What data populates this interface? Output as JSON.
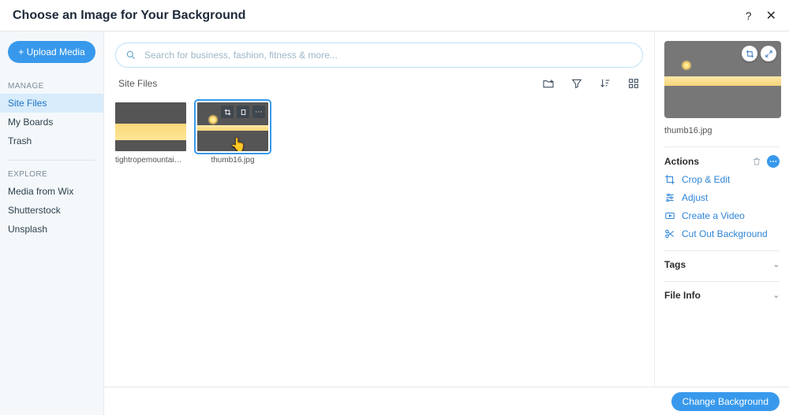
{
  "header": {
    "title": "Choose an Image for Your Background"
  },
  "sidebar": {
    "upload_label": "+ Upload Media",
    "section_manage": "MANAGE",
    "manage_items": [
      "Site Files",
      "My Boards",
      "Trash"
    ],
    "section_explore": "EXPLORE",
    "explore_items": [
      "Media from Wix",
      "Shutterstock",
      "Unsplash"
    ],
    "selected_manage_index": 0
  },
  "search": {
    "placeholder": "Search for business, fashion, fitness & more..."
  },
  "toolbar": {
    "breadcrumb": "Site Files"
  },
  "files": [
    {
      "name": "tightropemountains.jpg",
      "selected": false,
      "scene": "sunset"
    },
    {
      "name": "thumb16.jpg",
      "selected": true,
      "scene": "beach"
    }
  ],
  "details": {
    "filename": "thumb16.jpg",
    "actions_header": "Actions",
    "actions": [
      {
        "id": "crop-edit",
        "label": "Crop & Edit"
      },
      {
        "id": "adjust",
        "label": "Adjust"
      },
      {
        "id": "make-video",
        "label": "Create a Video"
      },
      {
        "id": "cut-out",
        "label": "Cut Out Background"
      }
    ],
    "tags_header": "Tags",
    "fileinfo_header": "File Info"
  },
  "footer": {
    "cta_label": "Change Background"
  },
  "colors": {
    "accent": "#3899ec"
  }
}
